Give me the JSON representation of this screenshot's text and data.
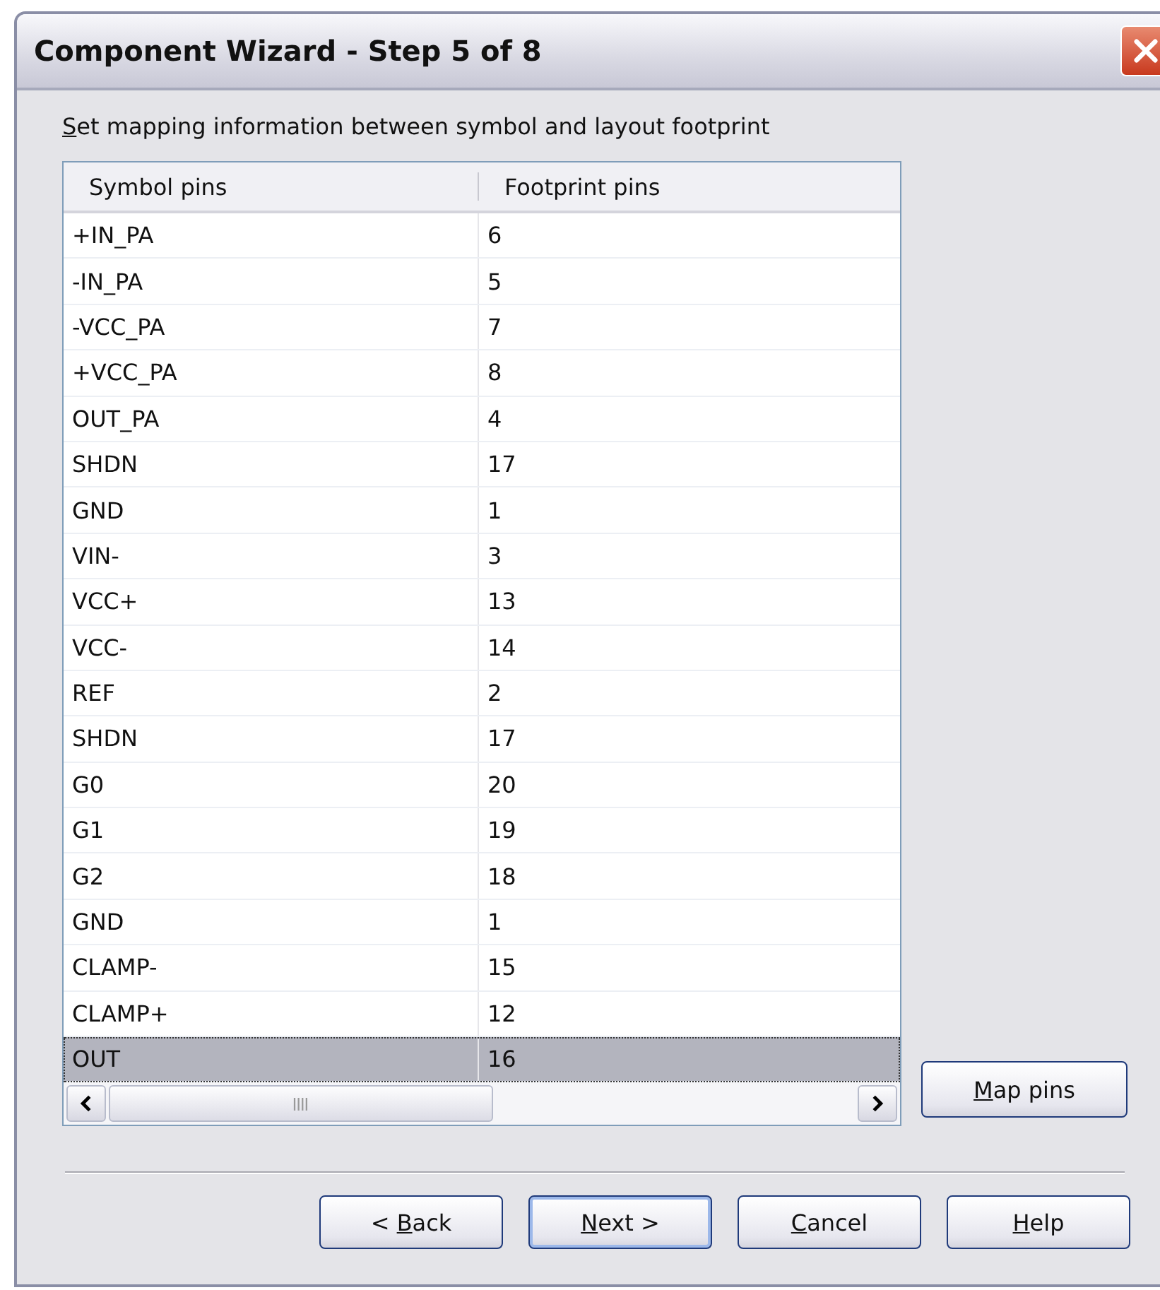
{
  "window": {
    "title": "Component Wizard - Step 5 of 8"
  },
  "instruction": {
    "key": "S",
    "rest": "et mapping information between symbol and layout footprint"
  },
  "table": {
    "columns": [
      "Symbol pins",
      "Footprint pins"
    ],
    "rows": [
      {
        "cells": [
          "+IN_PA",
          "6"
        ],
        "selected": false
      },
      {
        "cells": [
          "-IN_PA",
          "5"
        ],
        "selected": false
      },
      {
        "cells": [
          "-VCC_PA",
          "7"
        ],
        "selected": false
      },
      {
        "cells": [
          "+VCC_PA",
          "8"
        ],
        "selected": false
      },
      {
        "cells": [
          "OUT_PA",
          "4"
        ],
        "selected": false
      },
      {
        "cells": [
          "SHDN",
          "17"
        ],
        "selected": false
      },
      {
        "cells": [
          "GND",
          "1"
        ],
        "selected": false
      },
      {
        "cells": [
          "VIN-",
          "3"
        ],
        "selected": false
      },
      {
        "cells": [
          "VCC+",
          "13"
        ],
        "selected": false
      },
      {
        "cells": [
          "VCC-",
          "14"
        ],
        "selected": false
      },
      {
        "cells": [
          "REF",
          "2"
        ],
        "selected": false
      },
      {
        "cells": [
          "SHDN",
          "17"
        ],
        "selected": false
      },
      {
        "cells": [
          "G0",
          "20"
        ],
        "selected": false
      },
      {
        "cells": [
          "G1",
          "19"
        ],
        "selected": false
      },
      {
        "cells": [
          "G2",
          "18"
        ],
        "selected": false
      },
      {
        "cells": [
          "GND",
          "1"
        ],
        "selected": false
      },
      {
        "cells": [
          "CLAMP-",
          "15"
        ],
        "selected": false
      },
      {
        "cells": [
          "CLAMP+",
          "12"
        ],
        "selected": false
      },
      {
        "cells": [
          "OUT",
          "16"
        ],
        "selected": true
      }
    ]
  },
  "map_button": {
    "key": "M",
    "rest": "ap pins"
  },
  "buttons": [
    {
      "pre": "< ",
      "key": "B",
      "rest": "ack",
      "default": false
    },
    {
      "key": "N",
      "rest": "ext >",
      "default": true
    },
    {
      "key": "C",
      "rest": "ancel",
      "default": false
    },
    {
      "key": "H",
      "rest": "elp",
      "default": false
    }
  ]
}
